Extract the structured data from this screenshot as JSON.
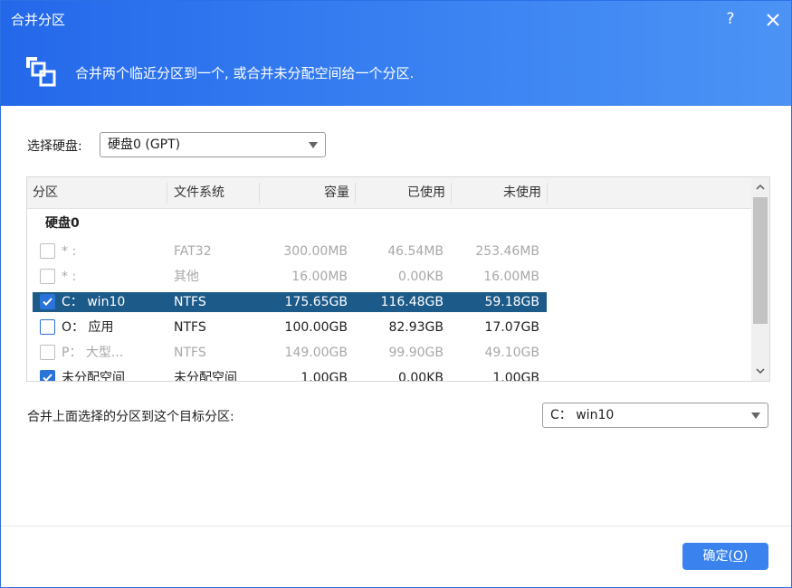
{
  "window": {
    "title": "合并分区",
    "help_label": "?",
    "description": "合并两个临近分区到一个, 或合并未分配空间给一个分区."
  },
  "disk_select": {
    "label": "选择硬盘:",
    "value": "硬盘0 (GPT)"
  },
  "table": {
    "columns": [
      "分区",
      "文件系统",
      "容量",
      "已使用",
      "未使用"
    ],
    "group_label": "硬盘0",
    "rows": [
      {
        "name": "* :",
        "fs": "FAT32",
        "capacity": "300.00MB",
        "used": "46.54MB",
        "unused": "253.46MB",
        "state": "disabled",
        "checked": false
      },
      {
        "name": "* :",
        "fs": "其他",
        "capacity": "16.00MB",
        "used": "0.00KB",
        "unused": "16.00MB",
        "state": "disabled",
        "checked": false
      },
      {
        "name": "C： win10",
        "fs": "NTFS",
        "capacity": "175.65GB",
        "used": "116.48GB",
        "unused": "59.18GB",
        "state": "selected",
        "checked": true
      },
      {
        "name": "O： 应用",
        "fs": "NTFS",
        "capacity": "100.00GB",
        "used": "82.93GB",
        "unused": "17.07GB",
        "state": "enabled",
        "checked": false
      },
      {
        "name": "P： 大型...",
        "fs": "NTFS",
        "capacity": "149.00GB",
        "used": "99.90GB",
        "unused": "49.10GB",
        "state": "disabled",
        "checked": false
      },
      {
        "name": "未分配空间",
        "fs": "未分配空间",
        "capacity": "1.00GB",
        "used": "0.00KB",
        "unused": "1.00GB",
        "state": "enabled",
        "checked": true
      }
    ]
  },
  "target": {
    "label": "合并上面选择的分区到这个目标分区:",
    "value": "C： win10"
  },
  "ok_button": {
    "label": "确定(",
    "hotkey": "O",
    "label_end": ")"
  },
  "colors": {
    "header_blue": "#2468ea",
    "selected_row": "#1c5a8a",
    "checkbox_blue": "#2a73d9",
    "button_blue": "#3a83ef"
  }
}
